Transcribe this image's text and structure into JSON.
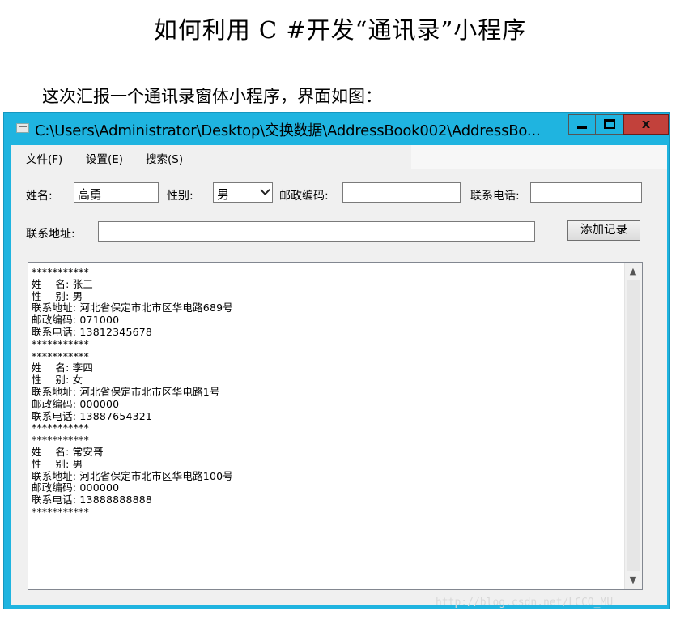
{
  "document": {
    "title": "如何利用 C #开发“通讯录”小程序",
    "paragraph": "这次汇报一个通讯录窗体小程序，界面如图："
  },
  "window": {
    "title": "C:\\Users\\Administrator\\Desktop\\交换数据\\AddressBook002\\AddressBo...",
    "icon": "app-window-icon",
    "controls": {
      "minimize": "minimize-icon",
      "maximize": "maximize-icon",
      "close_label": "x"
    }
  },
  "menu": {
    "items": [
      "文件(F)",
      "设置(E)",
      "搜索(S)"
    ]
  },
  "form": {
    "name_label": "姓名:",
    "name_value": "高勇",
    "gender_label": "性别:",
    "gender_value": "男",
    "postcode_label": "邮政编码:",
    "postcode_value": "",
    "phone_label": "联系电话:",
    "phone_value": "",
    "address_label": "联系地址:",
    "address_value": "",
    "add_button": "添加记录"
  },
  "records_text": "***********\n姓    名: 张三\n性    别: 男\n联系地址: 河北省保定市北市区华电路689号\n邮政编码: 071000\n联系电话: 13812345678\n***********\n***********\n姓    名: 李四\n性    别: 女\n联系地址: 河北省保定市北市区华电路1号\n邮政编码: 000000\n联系电话: 13887654321\n***********\n***********\n姓    名: 常安哥\n性    别: 男\n联系地址: 河北省保定市北市区华电路100号\n邮政编码: 000000\n联系电话: 13888888888\n***********",
  "scrollbar": {
    "up": "▲",
    "down": "▼"
  },
  "watermark": "http://blog.csdn.net/LCCO_MU",
  "colors": {
    "titlebar": "#1fb4e0",
    "close_button": "#c2413b",
    "client": "#f0f0f0"
  }
}
